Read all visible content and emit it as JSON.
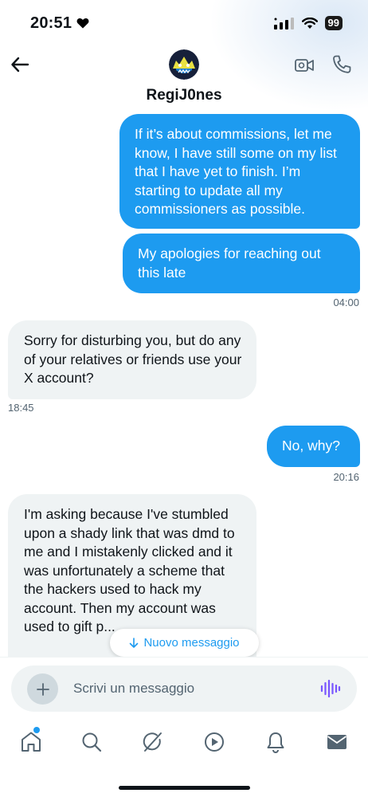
{
  "status": {
    "time": "20:51",
    "battery": "99"
  },
  "header": {
    "name": "RegiJ0nes"
  },
  "messages": [
    {
      "dir": "out",
      "text": "If it’s about commissions, let me know, I have still some on my list that I have yet to finish. I’m starting to update all my commissioners as possible."
    },
    {
      "dir": "out",
      "text": "My apologies for reaching out this late",
      "time": "04:00"
    },
    {
      "dir": "in",
      "text": "Sorry for disturbing you, but do any of your relatives or friends use your X account?",
      "time": "18:45"
    },
    {
      "dir": "out",
      "text": "No, why?",
      "time": "20:16"
    },
    {
      "dir": "in",
      "text": "I'm asking because I've stumbled upon a shady link that was dmd to me and I mistakenly clicked and it was unfortunately a scheme that the hackers used to hack my account. Then my account was used to gift p..."
    }
  ],
  "new_message_pill": {
    "label": "Nuovo messaggio",
    "icon": "arrow-down-icon"
  },
  "composer": {
    "placeholder": "Scrivi un messaggio"
  },
  "tabs": [
    "home-icon",
    "search-icon",
    "grok-icon",
    "video-icon",
    "notifications-icon",
    "messages-icon"
  ],
  "colors": {
    "accent": "#1d9bf0",
    "incoming_bubble": "#eff3f4",
    "text": "#0f1419",
    "muted": "#536471",
    "voice": "#7856ff"
  }
}
